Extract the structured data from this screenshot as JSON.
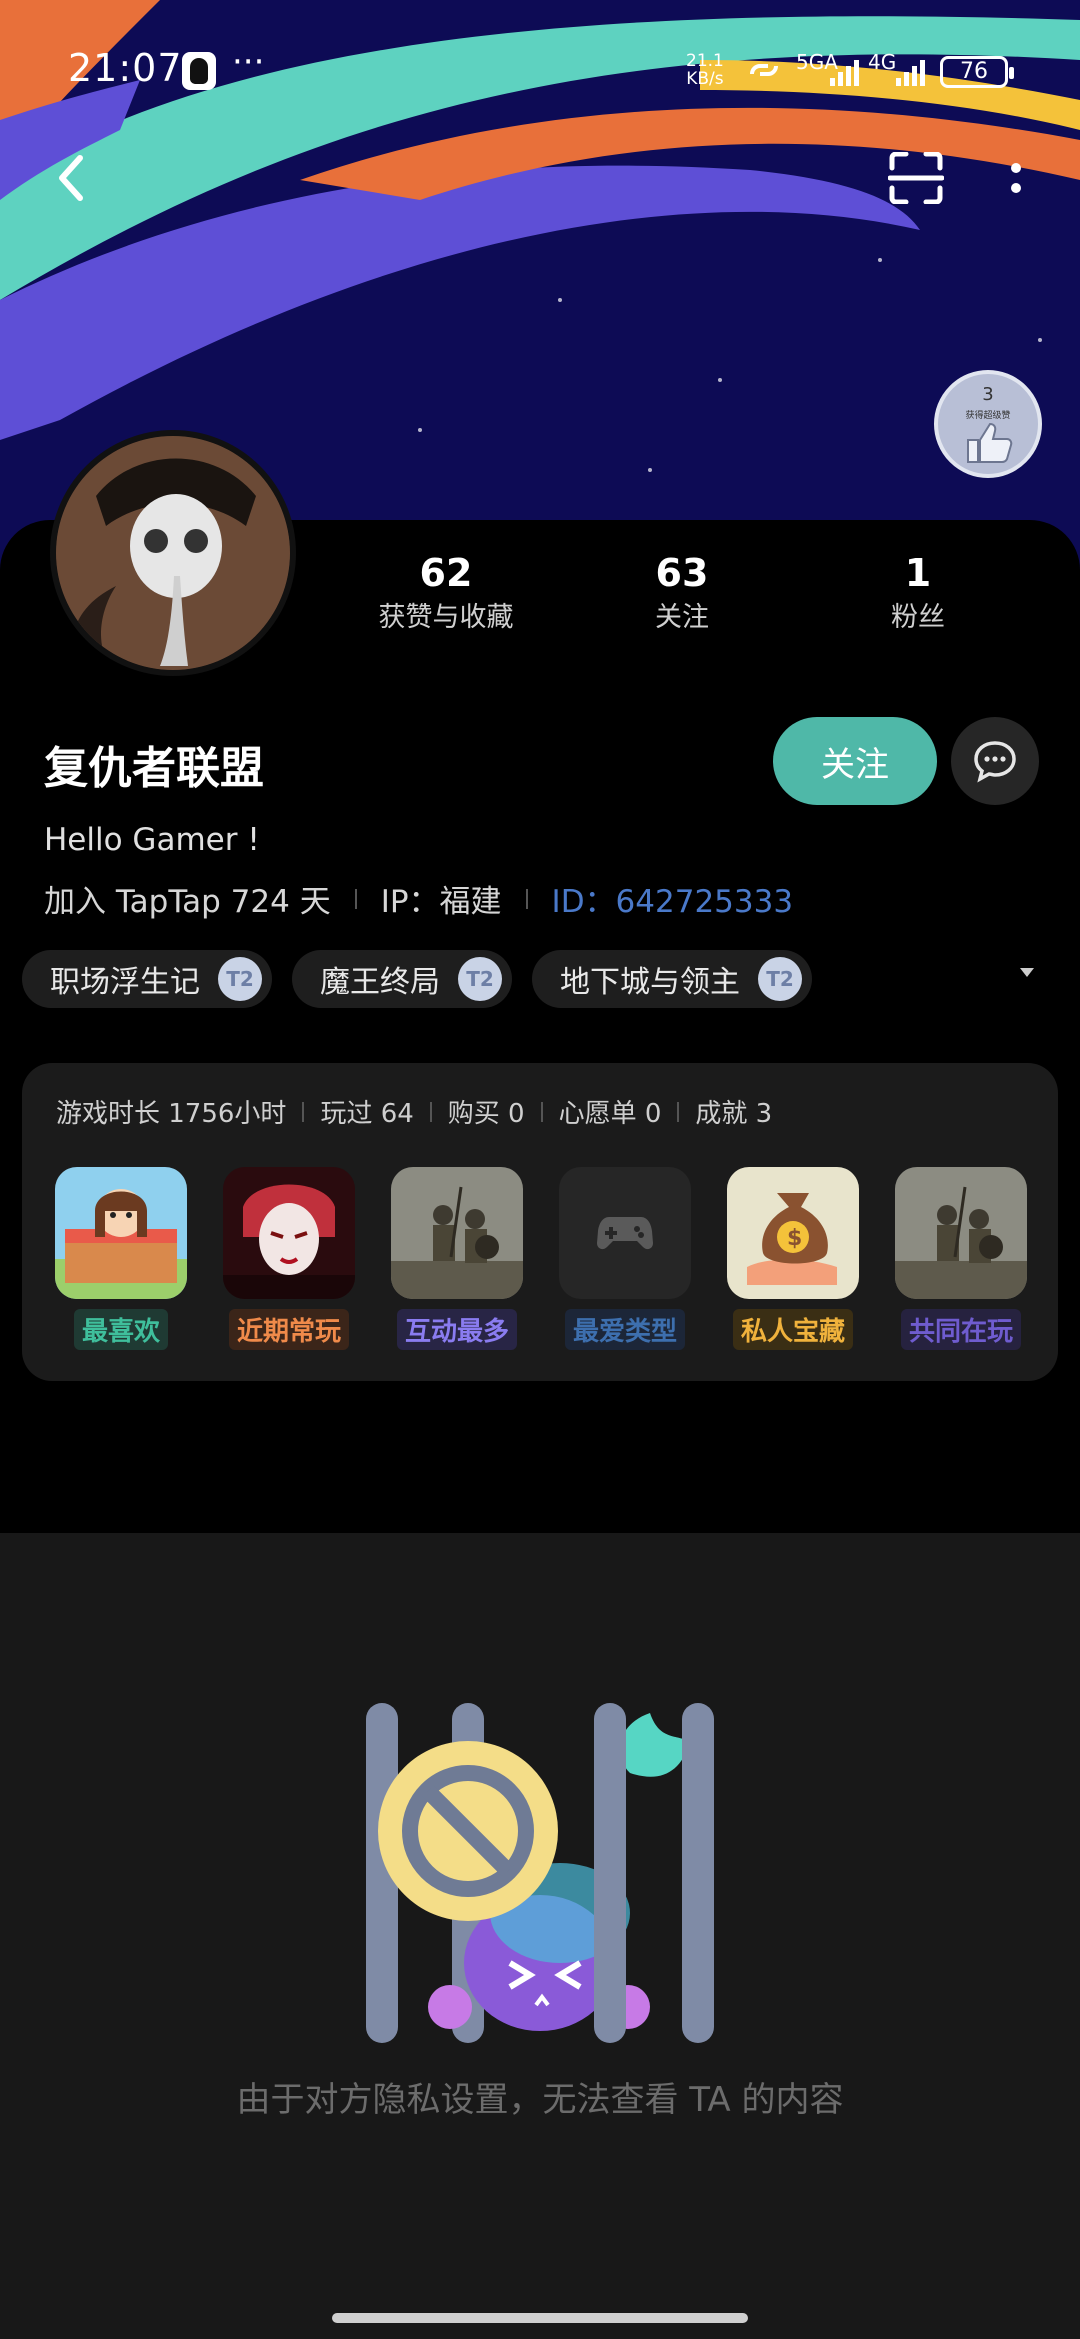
{
  "status_bar": {
    "time": "21:07",
    "more": "···",
    "net_speed_value": "21.1",
    "net_speed_unit": "KB/s",
    "signal_1": "5GA",
    "signal_2": "4G",
    "battery": "76"
  },
  "header": {
    "back_icon": "chevron-left-icon",
    "scan_icon": "scan-icon",
    "more_icon": "vertical-dots-icon",
    "medal_number": "3",
    "medal_text": "获得超级赞"
  },
  "profile": {
    "stats": [
      {
        "value": "62",
        "label": "获赞与收藏"
      },
      {
        "value": "63",
        "label": "关注"
      },
      {
        "value": "1",
        "label": "粉丝"
      }
    ],
    "username": "复仇者联盟",
    "follow_label": "关注",
    "bio": "Hello Gamer !",
    "joined": "加入 TapTap 724 天",
    "ip": "IP：福建",
    "id": "ID：642725333"
  },
  "tags": [
    {
      "label": "职场浮生记",
      "badge": "T2"
    },
    {
      "label": "魔王终局",
      "badge": "T2"
    },
    {
      "label": "地下城与领主",
      "badge": "T2"
    }
  ],
  "game_stats": {
    "playtime": "游戏时长 1756小时",
    "played": "玩过 64",
    "bought": "购买 0",
    "wishlist": "心愿单 0",
    "achievements": "成就 3"
  },
  "games": [
    {
      "label": "最喜欢",
      "color": "#3fbf9c",
      "bg": "#1f3a33"
    },
    {
      "label": "近期常玩",
      "color": "#ef8a4a",
      "bg": "#3b2519"
    },
    {
      "label": "互动最多",
      "color": "#8a7cf0",
      "bg": "#282545"
    },
    {
      "label": "最爱类型",
      "color": "#3d6fae",
      "bg": "#1c2638"
    },
    {
      "label": "私人宝藏",
      "color": "#f0b23c",
      "bg": "#3a2e14"
    },
    {
      "label": "共同在玩",
      "color": "#6f5ccf",
      "bg": "#26223f"
    }
  ],
  "private_message": "由于对方隐私设置，无法查看 TA 的内容"
}
